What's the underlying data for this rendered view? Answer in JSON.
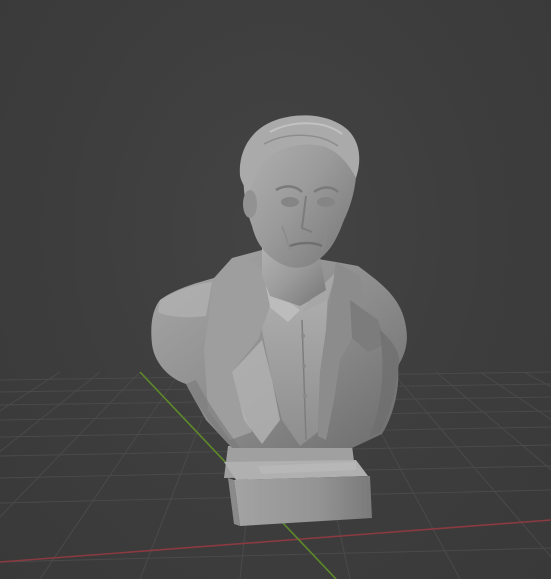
{
  "viewport": {
    "background_color": "#3d3d3d",
    "grid_line_color": "#4a4a4a",
    "x_axis_color": "#8a3a40",
    "y_axis_color": "#5e8a2a",
    "mesh_color": "#9a9a9a"
  },
  "scene_object": {
    "kind": "sculpted-bust",
    "parts": [
      "head",
      "hair",
      "face",
      "collar",
      "shirt",
      "coat",
      "shoulders",
      "pedestal"
    ]
  }
}
